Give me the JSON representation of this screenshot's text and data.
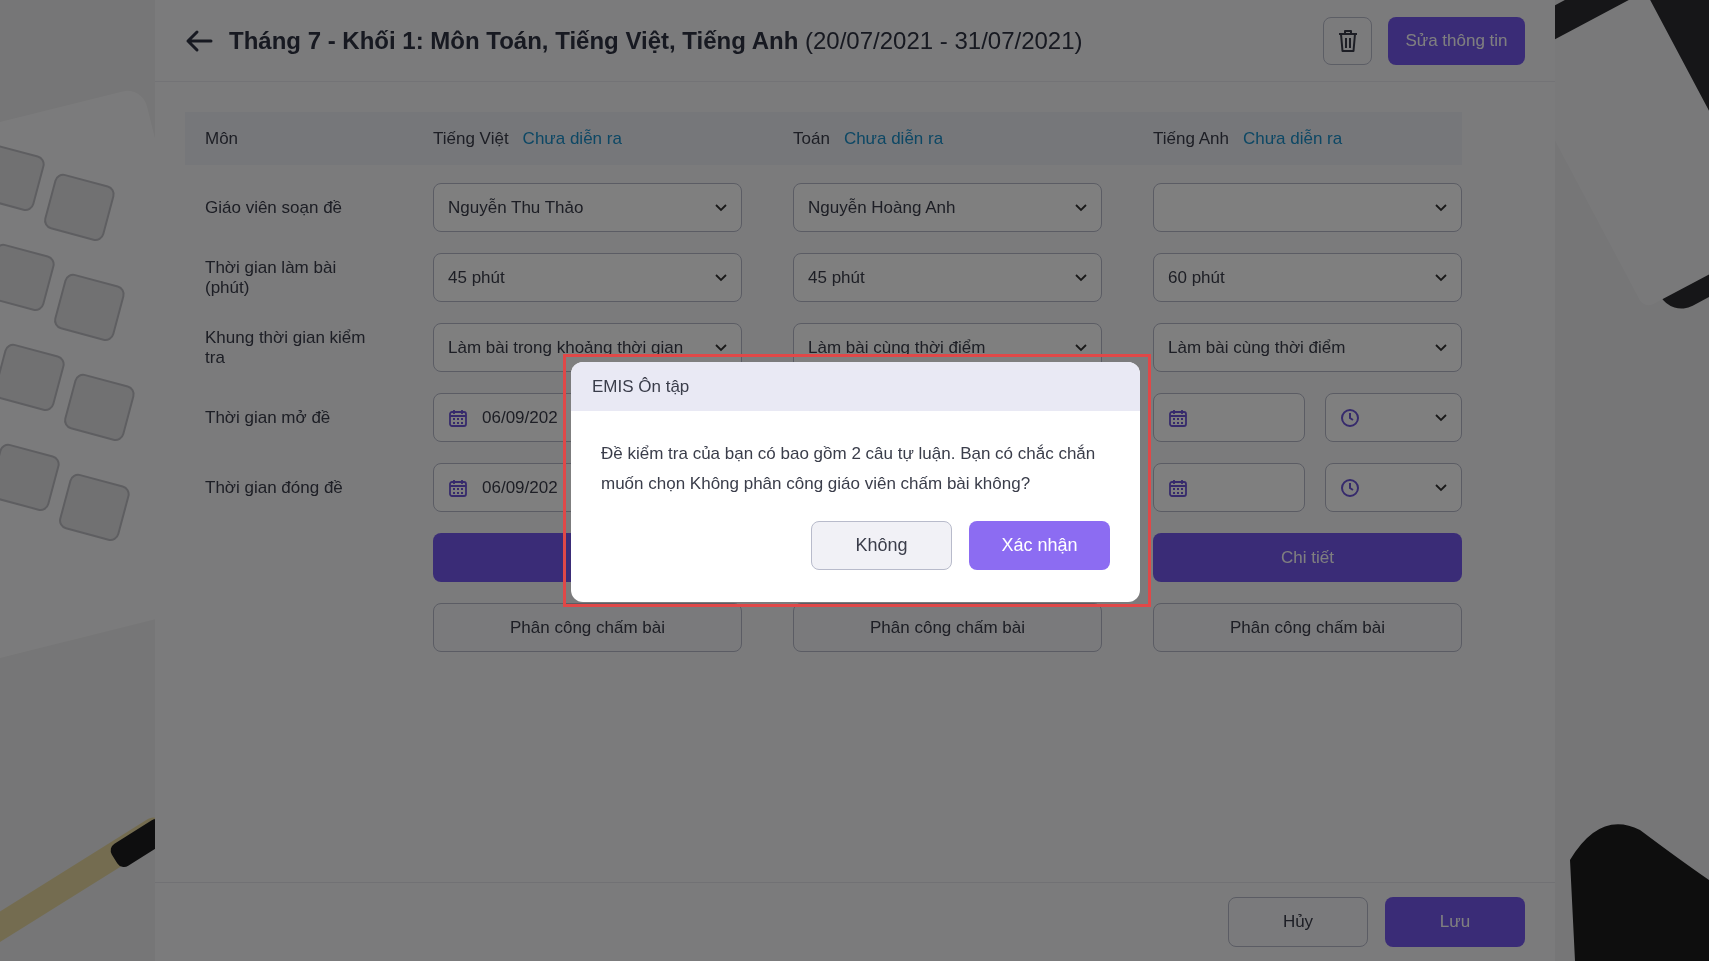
{
  "header": {
    "title": "**Tháng 7 - Khối 1: Môn Toán, Tiếng Việt, Tiếng Anh** (20/07/2021 - 31/07/2021)",
    "edit_button": "Sửa thông tin"
  },
  "table": {
    "subject_label": "Môn",
    "subjects": [
      {
        "name": "Tiếng Việt",
        "status": "Chưa diễn ra"
      },
      {
        "name": "Toán",
        "status": "Chưa diễn ra"
      },
      {
        "name": "Tiếng Anh",
        "status": "Chưa diễn ra"
      }
    ],
    "rows": [
      {
        "label": "Giáo viên soạn đề",
        "kind": "select",
        "cells": [
          {
            "value": "Nguyễn Thu Thảo"
          },
          {
            "value": "Nguyễn Hoàng Anh"
          },
          {}
        ]
      },
      {
        "label": "Thời gian làm bài (phút)",
        "kind": "select",
        "cells": [
          {
            "value": "45 phút"
          },
          {
            "value": "45 phút"
          },
          {
            "value": "60 phút"
          }
        ]
      },
      {
        "label": "Khung thời gian kiểm tra",
        "kind": "select",
        "cells": [
          {
            "value": "Làm bài trong khoảng thời gian"
          },
          {
            "value": "Làm bài cùng thời điểm"
          },
          {
            "value": "Làm bài cùng thời điểm"
          }
        ]
      },
      {
        "label": "Thời gian mở đề",
        "kind": "datetime",
        "cells": [
          {
            "kind": "fields",
            "parts": [
              {
                "kind": "date",
                "value": "06/09/202"
              }
            ]
          },
          {
            "kind": "covered"
          },
          {
            "kind": "fields",
            "parts": [
              {
                "kind": "date"
              },
              {
                "kind": "time"
              }
            ]
          }
        ]
      },
      {
        "label": "Thời gian đóng đề",
        "kind": "datetime",
        "cells": [
          {
            "kind": "fields",
            "parts": [
              {
                "kind": "date",
                "value": "06/09/202"
              }
            ]
          },
          {
            "kind": "covered"
          },
          {
            "kind": "fields",
            "parts": [
              {
                "kind": "date"
              },
              {
                "kind": "time"
              }
            ]
          }
        ]
      }
    ],
    "detail_buttons": [
      {
        "kind": "button"
      },
      {
        "kind": "covered"
      },
      {
        "kind": "button",
        "label": "Chi tiết"
      }
    ],
    "assign_buttons": [
      "Phân công chấm bài",
      "Phân công chấm bài",
      "Phân công chấm bài"
    ]
  },
  "footer": {
    "cancel_button": "Hủy",
    "save_button": "Lưu"
  },
  "dialog": {
    "title": "EMIS Ôn tập",
    "message": "Đề kiểm tra của bạn có bao gồm 2 câu tự luận. Bạn có chắc chắn muốn chọn Không phân công giáo viên chấm bài không?",
    "highlighted": true,
    "buttons": [
      {
        "label": "Không",
        "kind": "secondary"
      },
      {
        "label": "Xác nhận",
        "kind": "primary"
      }
    ]
  }
}
